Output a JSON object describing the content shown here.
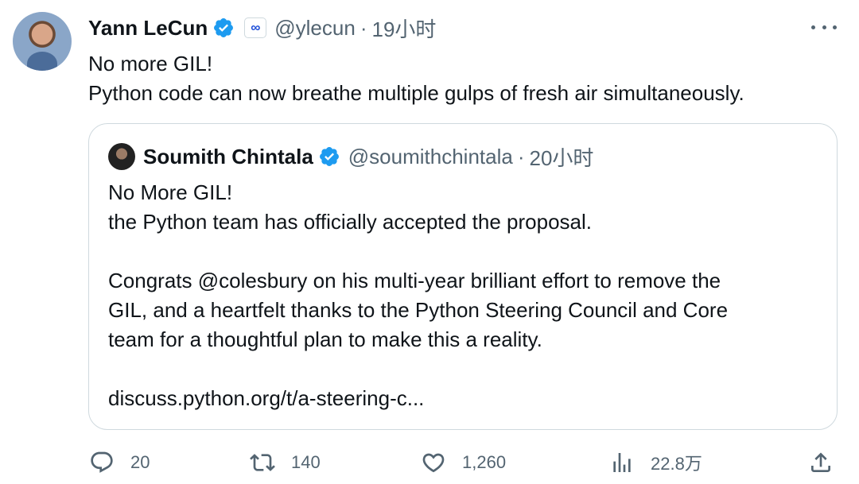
{
  "author": {
    "display_name": "Yann LeCun",
    "handle": "@ylecun",
    "separator": "·",
    "time": "19小时",
    "affiliate_badge": "∞",
    "verified_color": "#1d9bf0"
  },
  "tweet": {
    "lines": [
      "No more GIL!",
      "Python code can now breathe multiple gulps of fresh air simultaneously."
    ]
  },
  "quote": {
    "display_name": "Soumith Chintala",
    "handle": "@soumithchintala",
    "separator": "·",
    "time": "20小时",
    "lines": [
      "No More GIL!",
      "the Python team has officially accepted the proposal.",
      "",
      "Congrats @colesbury on his multi-year brilliant effort to remove the",
      "GIL, and a heartfelt thanks to the Python Steering Council and Core",
      "team for a thoughtful plan to make this a reality.",
      "",
      "discuss.python.org/t/a-steering-c..."
    ]
  },
  "actions": {
    "replies": "20",
    "retweets": "140",
    "likes": "1,260",
    "views": "22.8万"
  },
  "icons": {
    "reply": "reply-icon",
    "retweet": "retweet-icon",
    "like": "heart-icon",
    "views": "views-icon",
    "share": "share-icon",
    "more": "more-icon",
    "verified": "verified-icon",
    "affiliate": "meta-affiliate-icon"
  }
}
